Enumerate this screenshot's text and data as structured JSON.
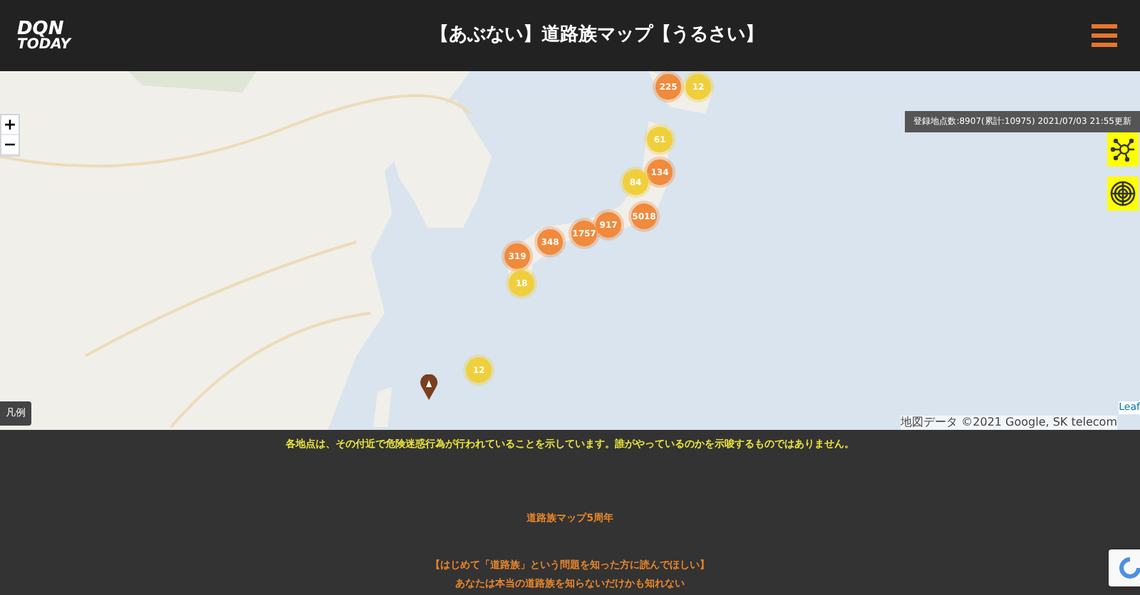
{
  "header": {
    "logo": [
      "DQN",
      "TODAY"
    ],
    "title": "【あぶない】道路族マップ【うるさい】"
  },
  "map": {
    "status": "登録地点数:8907(累計:10975) 2021/07/03 21:55更新",
    "zoom_buttons": [
      "+",
      "−"
    ],
    "legend_button": "凡例",
    "clusters": [
      {
        "count": "225",
        "color": "#f08a3c"
      },
      {
        "count": "12",
        "color": "#f0cf3c"
      },
      {
        "count": "61",
        "color": "#f0cf3c"
      },
      {
        "count": "134",
        "color": "#f08a3c"
      },
      {
        "count": "84",
        "color": "#f0cf3c"
      },
      {
        "count": "5018",
        "color": "#f08a3c"
      },
      {
        "count": "917",
        "color": "#f08a3c"
      },
      {
        "count": "1757",
        "color": "#f08a3c"
      },
      {
        "count": "348",
        "color": "#f08a3c"
      },
      {
        "count": "319",
        "color": "#f08a3c"
      },
      {
        "count": "18",
        "color": "#f0cf3c"
      },
      {
        "count": "12",
        "color": "#f0cf3c"
      }
    ],
    "attribution": "地図データ ©2021 Google, SK telecom",
    "leaflet": "Leaf"
  },
  "footer": {
    "notice": "各地点は、その付近で危険迷惑行為が行われていることを示しています。誰がやっているのかを示唆するものではありません。",
    "anniversary": "道路族マップ5周年",
    "intro_heading": "【はじめて「道路族」という問題を知った方に読んでほしい】",
    "intro_line": "あなたは本当の道路族を知らないだけかも知れない"
  }
}
